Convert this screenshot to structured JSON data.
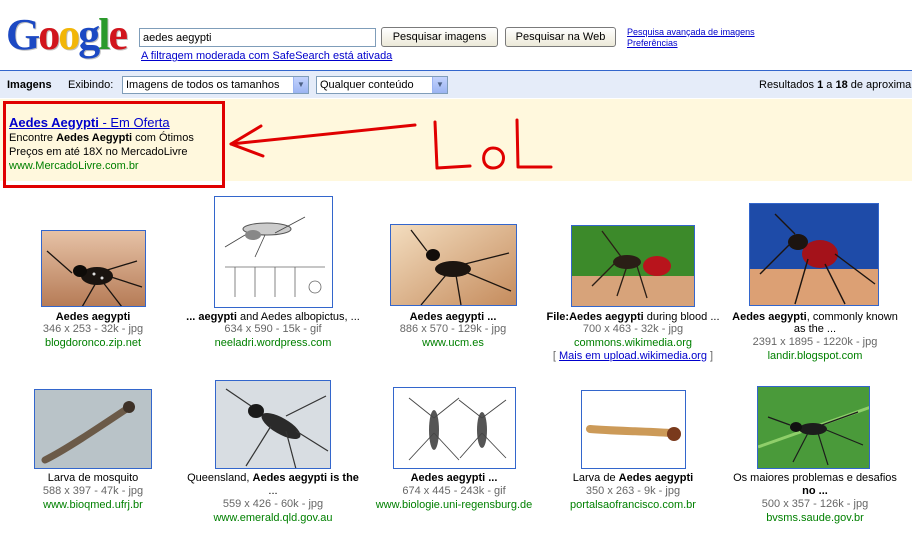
{
  "header": {
    "logo_letters": [
      "G",
      "o",
      "o",
      "g",
      "l",
      "e"
    ],
    "logo_colors": [
      "#1c49c3",
      "#d1151d",
      "#f2b608",
      "#1c49c3",
      "#2b9a2c",
      "#d1151d"
    ],
    "query": "aedes aegypti",
    "btn_images": "Pesquisar imagens",
    "btn_web": "Pesquisar na Web",
    "safesearch": "A filtragem moderada com SafeSearch está ativada",
    "advanced": "Pesquisa avançada de imagens",
    "prefs": "Preferências"
  },
  "toolbar": {
    "title": "Imagens",
    "showing": "Exibindo:",
    "size_select": "Imagens de todos os tamanhos",
    "content_select": "Qualquer conteúdo",
    "results_prefix": "Resultados ",
    "results_from": "1",
    "results_mid": " a ",
    "results_to": "18",
    "results_suffix": " de aproxima"
  },
  "ad": {
    "title_bold": "Aedes Aegypti",
    "title_rest": " - Em Oferta",
    "line1_pre": "Encontre ",
    "line1_bold": "Aedes Aegypti",
    "line1_post": " com Ótimos",
    "line2": "Preços em até 18X no MercadoLivre",
    "url": "www.MercadoLivre.com.br"
  },
  "annotation": {
    "text": "LoL",
    "color": "#e00000"
  },
  "results": [
    {
      "cap1": "Aedes aegypti",
      "cap1_rest": "",
      "cap2": "",
      "meta": "346 x 253 - 32k - jpg",
      "site": "blogdoronco.zip.net"
    },
    {
      "cap1": "... aegypti",
      "cap1_rest": " and Aedes albopictus, ...",
      "cap2": "",
      "meta": "634 x 590 - 15k - gif",
      "site": "neeladri.wordpress.com"
    },
    {
      "cap1": "Aedes aegypti ...",
      "cap1_rest": "",
      "cap2": "",
      "meta": "886 x 570 - 129k - jpg",
      "site": "www.ucm.es"
    },
    {
      "cap1": "File:Aedes aegypti",
      "cap1_rest": " during blood ...",
      "cap2": "",
      "meta": "700 x 463 - 32k - jpg",
      "site": "commons.wikimedia.org",
      "more": "Mais em upload.wikimedia.org"
    },
    {
      "cap1": "Aedes aegypti",
      "cap1_rest": ", commonly known",
      "cap2": "as the ...",
      "meta": "2391 x 1895 - 1220k - jpg",
      "site": "landir.blogspot.com"
    },
    {
      "cap1": "Larva de mosquito",
      "cap1_rest": "",
      "cap2": "",
      "meta": "588 x 397 - 47k - jpg",
      "site": "www.bioqmed.ufrj.br"
    },
    {
      "cap1": "Queensland, ",
      "cap1_rest": "Aedes aegypti is the",
      "cap2": "...",
      "meta": "559 x 426 - 60k - jpg",
      "site": "www.emerald.qld.gov.au"
    },
    {
      "cap1": "Aedes aegypti ...",
      "cap1_rest": "",
      "cap2": "",
      "meta": "674 x 445 - 243k - gif",
      "site": "www.biologie.uni-regensburg.de"
    },
    {
      "cap1": "Larva de ",
      "cap1_rest": "Aedes aegypti",
      "cap2": "",
      "meta": "350 x 263 - 9k - jpg",
      "site": "portalsaofrancisco.com.br"
    },
    {
      "cap1": "Os maiores problemas e desafios",
      "cap1_rest": "",
      "cap2": "no ...",
      "meta": "500 x 357 - 126k - jpg",
      "site": "bvsms.saude.gov.br"
    }
  ]
}
